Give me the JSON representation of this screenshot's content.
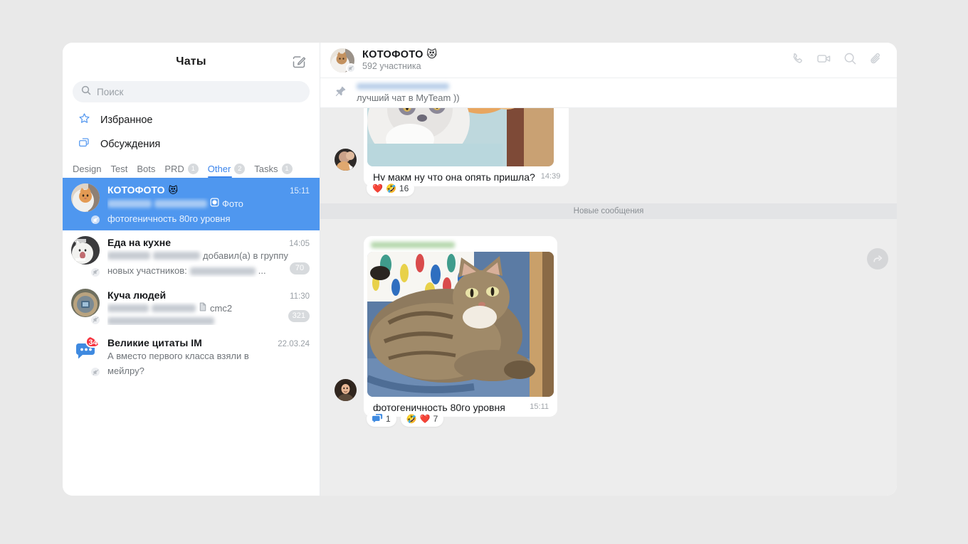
{
  "window": {
    "background": "#e9e9e9",
    "surface": "#ffffff"
  },
  "accent": "#3b84eb",
  "selected_row_color": "#4f97ef",
  "sidebar": {
    "title": "Чаты",
    "compose_icon": "compose-pencil-icon",
    "search": {
      "placeholder": "Поиск",
      "value": "",
      "icon": "search-icon"
    },
    "quick_nav": [
      {
        "label": "Избранное",
        "icon": "star-icon"
      },
      {
        "label": "Обсуждения",
        "icon": "discussions-icon"
      }
    ],
    "tabs": [
      {
        "label": "Design",
        "badge": "",
        "active": false
      },
      {
        "label": "Test",
        "badge": "",
        "active": false
      },
      {
        "label": "Bots",
        "badge": "",
        "active": false
      },
      {
        "label": "PRD",
        "badge": "1",
        "active": false
      },
      {
        "label": "Other",
        "badge": "2",
        "active": true
      },
      {
        "label": "Tasks",
        "badge": "1",
        "active": false
      }
    ],
    "chats": [
      {
        "name": "КОТОФОТО",
        "emoji": "😻",
        "time": "15:11",
        "preview_attachment": "Фото",
        "preview_line2": "фотогеничность 80го уровня",
        "badge": "",
        "selected": true,
        "muted": true,
        "avatar": "orange-cat-avatar"
      },
      {
        "name": "Еда на кухне",
        "emoji": "",
        "time": "14:05",
        "preview_part1": "добавил(а) в группу",
        "preview_line2": "новых участников:",
        "preview_tail": "...",
        "badge": "70",
        "selected": false,
        "muted": true,
        "avatar": "screaming-cat-avatar"
      },
      {
        "name": "Куча людей",
        "emoji": "",
        "time": "11:30",
        "preview_attachment": "cmc2",
        "badge": "321",
        "selected": false,
        "muted": true,
        "avatar": "round-object-avatar"
      },
      {
        "name": "Великие цитаты IM",
        "emoji": "",
        "time": "22.03.24",
        "preview_line1": "А вместо первого класса взяли в",
        "preview_line2": "мейлру?",
        "badge": "",
        "unread_count": "34",
        "selected": false,
        "muted": true,
        "avatar": "chat-bubble-avatar"
      }
    ]
  },
  "chat": {
    "title": "КОТОФОТО",
    "title_emoji": "😻",
    "subtitle": "592 участника",
    "muted": true,
    "header_actions": [
      {
        "icon": "phone-icon",
        "name": "call-button"
      },
      {
        "icon": "video-camera-icon",
        "name": "video-call-button"
      },
      {
        "icon": "search-icon",
        "name": "search-in-chat-button"
      },
      {
        "icon": "paperclip-icon",
        "name": "attachments-button"
      }
    ],
    "pinned": {
      "icon": "pin-icon",
      "author_hidden": true,
      "text": "лучший чат в MyTeam ))"
    },
    "divider_label": "Новые сообщения",
    "forward_button_icon": "forward-arrow-icon",
    "messages": [
      {
        "id": "msg-1",
        "photo": "two-cats-on-blue-blanket",
        "text": "Ну макм ну что она опять пришла?",
        "time": "14:39",
        "reactions": [
          {
            "emoji": "❤️",
            "emoji2": "🤣",
            "count": "16"
          }
        ]
      },
      {
        "id": "msg-2",
        "author_hidden": true,
        "photo": "tabby-cat-on-blue-couch",
        "text": "фотогеничность 80го уровня",
        "time": "15:11",
        "thread": {
          "icon": "thread-icon",
          "count": "1"
        },
        "reactions": [
          {
            "emoji": "🤣",
            "emoji2": "❤️",
            "count": "7"
          }
        ]
      }
    ]
  }
}
